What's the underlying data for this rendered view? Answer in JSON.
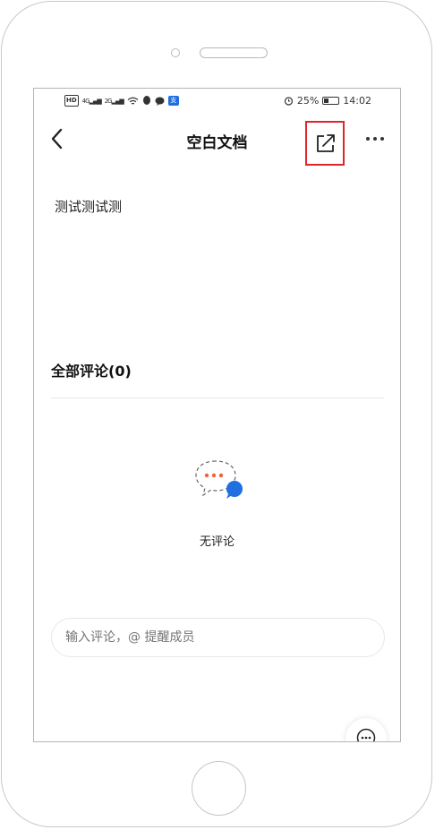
{
  "status_bar": {
    "left_tags": [
      "HD",
      "4G",
      "2G"
    ],
    "battery_percent": "25%",
    "time": "14:02"
  },
  "nav": {
    "title": "空白文档"
  },
  "document": {
    "body_text": "测试测试测"
  },
  "comments": {
    "header": "全部评论(0)",
    "empty_text": "无评论",
    "input_placeholder": "输入评论，@ 提醒成员"
  },
  "colors": {
    "highlight_border": "#e0242c",
    "accent_blue": "#1f6fe0",
    "dots_orange": "#f0623c"
  },
  "icons": [
    "back-icon",
    "share-external-icon",
    "more-icon",
    "comment-empty-icon",
    "comment-float-icon"
  ]
}
